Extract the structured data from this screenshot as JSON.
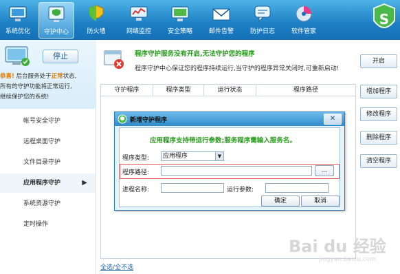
{
  "nav": [
    {
      "label": "系统优化",
      "icon": "monitor-icon"
    },
    {
      "label": "守护中心",
      "icon": "shield-monitor-icon",
      "active": true
    },
    {
      "label": "防火墙",
      "icon": "shield-icon"
    },
    {
      "label": "网络监控",
      "icon": "network-icon"
    },
    {
      "label": "安全策略",
      "icon": "monitor-check-icon"
    },
    {
      "label": "邮件告警",
      "icon": "mail-icon"
    },
    {
      "label": "防护日志",
      "icon": "chat-log-icon"
    },
    {
      "label": "软件管家",
      "icon": "cd-icon"
    }
  ],
  "logo": {
    "letter": "S"
  },
  "status": {
    "stop_label": "停止",
    "line1_prefix": "恭喜!",
    "line1_middle": "后台服务处于",
    "line1_highlight": "正常",
    "line1_suffix": "状态,",
    "line2": "所有的守护功能将正常运行,",
    "line3": "继续保护您的系统!"
  },
  "menu": [
    {
      "label": "帐号安全守护"
    },
    {
      "label": "远程桌面守护"
    },
    {
      "label": "文件目录守护"
    },
    {
      "label": "应用程序守护",
      "active": true,
      "arrow": "▶"
    },
    {
      "label": "系统资源守护"
    },
    {
      "label": "定时操作"
    }
  ],
  "notice": {
    "title": "程序守护服务没有开启,无法守护您的程序",
    "desc": "程序守护中心保证您的程序持续运行,当守护的程序异常关闭时,可重新启动!"
  },
  "table": {
    "headers": [
      "守护程序",
      "程序类型",
      "运行状态",
      "程序路径"
    ]
  },
  "buttons": {
    "start": "开启",
    "add": "增加程序",
    "modify": "修改程序",
    "delete": "删除程序",
    "clear": "清空程序"
  },
  "select_links": {
    "all": "全选",
    "sep": "/",
    "none": "全不选"
  },
  "dialog": {
    "title": "新增守护程序",
    "close": "✕",
    "hint": "应用程序支持带运行参数;服务程序需输入服务名。",
    "type_label": "程序类型:",
    "type_value": "应用程序",
    "path_label": "程序路径:",
    "path_value": "",
    "browse": "...",
    "name_label": "进程名称:",
    "name_value": "",
    "params_label": "运行参数:",
    "params_value": "",
    "ok": "确定",
    "cancel": "取消"
  },
  "watermark": {
    "text": "Bai du 经验",
    "sub": "jingyan.baidu.com"
  }
}
